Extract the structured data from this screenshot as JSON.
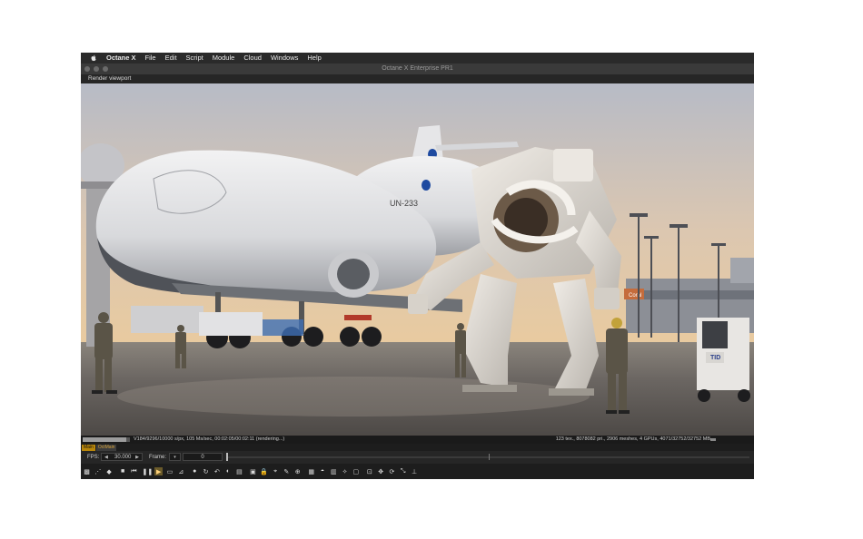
{
  "menubar": {
    "apple": "apple-icon",
    "items": [
      "Octane X",
      "File",
      "Edit",
      "Script",
      "Module",
      "Cloud",
      "Windows",
      "Help"
    ]
  },
  "window": {
    "title": "Octane X Enterprise PR1"
  },
  "panel": {
    "title": "Render viewport"
  },
  "status": {
    "progress": 0.92,
    "left": "V184/9296/10000 s/px, 105 Ms/sec, 00:02:05/00:02:11 (rendering...)",
    "right": "123 tex., 8078082 pri., 2906 meshes, 4 GPUs, 4071/32752/32752 MB"
  },
  "tabs": {
    "active": "Main",
    "other": "OctMain"
  },
  "timeline": {
    "fps_label": "FPS:",
    "fps_value": "30.000",
    "frame_label": "Frame:",
    "frame_value": "0"
  },
  "scene": {
    "aircraft_label": "UN-233",
    "logo": "NASA",
    "sign_text": "Coral",
    "robot_label": "TID",
    "colors": {
      "sky_top": "#b9bcc6",
      "sky_bottom": "#e7c9a4",
      "tarmac": "#6f6a66",
      "aircraft": "#e4e4e6"
    }
  },
  "toolbar": {
    "icons": [
      "render-settings-icon",
      "grid-icon",
      "color-cube-icon",
      "stop-icon",
      "restart-icon",
      "pause-icon",
      "play-icon",
      "screen-icon",
      "region-icon",
      "material-ball-icon",
      "refresh-icon",
      "undo-icon",
      "tone-icon",
      "layer-icon",
      "save-icon",
      "lock-icon",
      "focus-icon",
      "picker-icon",
      "zoom-icon",
      "film-icon",
      "clay-icon",
      "subsample-icon",
      "decal-icon",
      "camera-icon",
      "gizmo-icon",
      "move-icon",
      "rotate-icon",
      "scale-icon",
      "world-axis-icon"
    ],
    "glyphs": [
      "▩",
      "⋰",
      "◆",
      "■",
      "⏮",
      "❚❚",
      "▶",
      "▭",
      "⊿",
      "●",
      "↻",
      "↶",
      "◐",
      "▤",
      "▣",
      "🔒",
      "⌖",
      "✎",
      "⊕",
      "▦",
      "◓",
      "▥",
      "✧",
      "▢",
      "⊡",
      "✥",
      "⟳",
      "⤡",
      "⊥"
    ]
  }
}
